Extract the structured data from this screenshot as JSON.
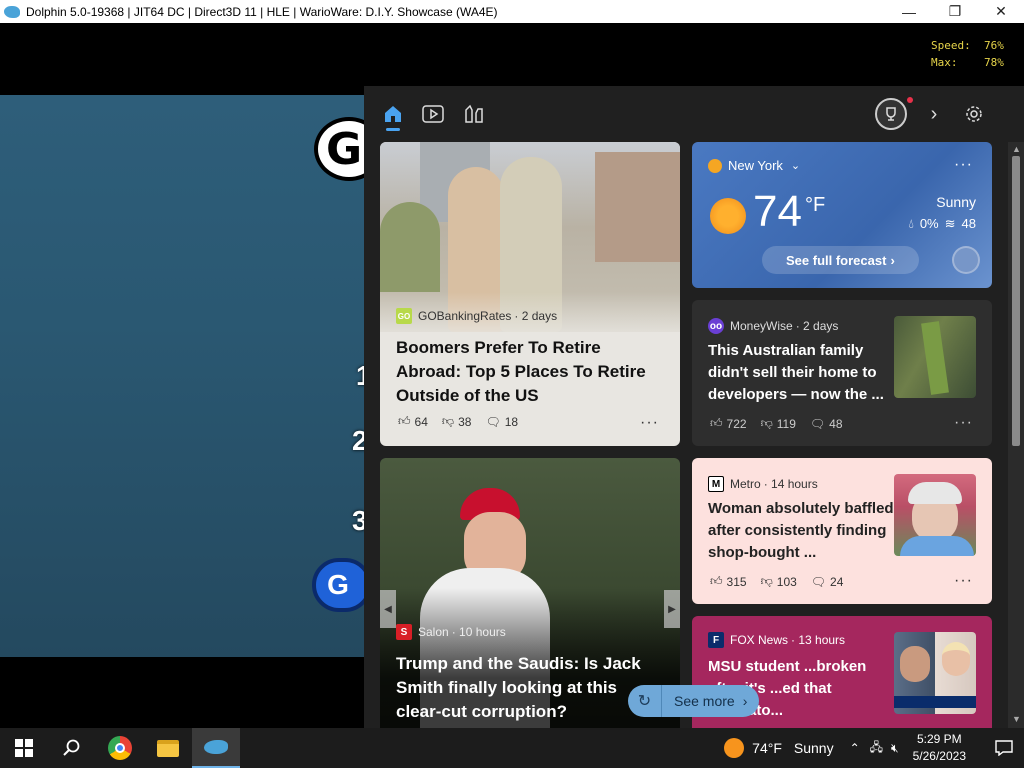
{
  "titlebar": {
    "title": "Dolphin 5.0-19368 | JIT64 DC | Direct3D 11 | HLE | WarioWare: D.I.Y. Showcase (WA4E)",
    "minimize": "—",
    "maximize": "❐",
    "close": "✕"
  },
  "game": {
    "letter1": "G",
    "num1": "1",
    "num2": "2",
    "num3": "3",
    "btn_letter": "G"
  },
  "overlay": {
    "speed": "Speed:  76%",
    "max": "Max:    78%"
  },
  "weather": {
    "location": "New York",
    "temp": "74",
    "unit": "°F",
    "condition": "Sunny",
    "precip": "0%",
    "wind": "48",
    "forecast_link": "See full forecast"
  },
  "cards": [
    {
      "source": "GOBankingRates",
      "age": "· 2 days",
      "logo": "GO",
      "title": "Boomers Prefer To Retire Abroad: Top 5 Places To Retire Outside of the US",
      "likes": "64",
      "dislikes": "38",
      "comments": "18"
    },
    {
      "source": "MoneyWise",
      "age": "· 2 days",
      "logo": "oo",
      "title": "This Australian family didn't sell their home to developers — now the ...",
      "likes": "722",
      "dislikes": "119",
      "comments": "48"
    },
    {
      "source": "Metro",
      "age": "· 14 hours",
      "logo": "M",
      "title": "Woman absolutely baffled after consistently finding shop-bought ...",
      "likes": "315",
      "dislikes": "103",
      "comments": "24"
    },
    {
      "source": "Salon",
      "age": "· 10 hours",
      "logo": "S",
      "title": "Trump and the Saudis: Is Jack Smith finally looking at this clear-cut corruption?"
    },
    {
      "source": "FOX News",
      "age": "· 13 hours",
      "logo": "F",
      "title": "MSU student ...broken after it's ...ed that mandato..."
    }
  ],
  "see_more": "See more",
  "taskbar": {
    "weather_temp": "74°F",
    "weather_cond": "Sunny",
    "time": "5:29 PM",
    "date": "5/26/2023"
  },
  "colors": {
    "panel_bg": "#202020",
    "weather_bg": "#3f6fb8",
    "accent": "#4aa3f0",
    "metro_bg": "#fde1de",
    "fox_bg": "#a5275e"
  }
}
